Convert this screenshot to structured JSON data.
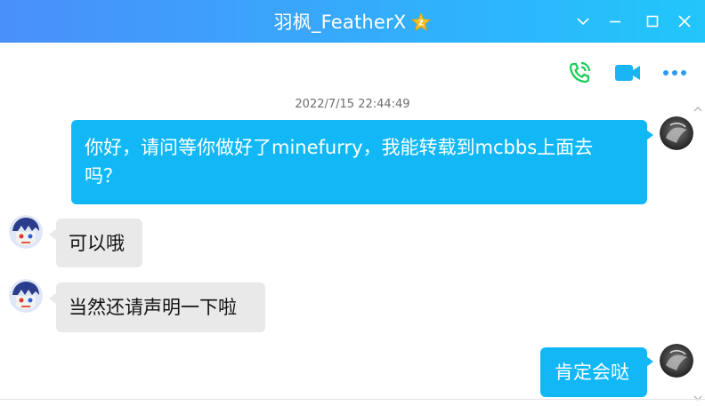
{
  "window": {
    "title": "羽枫_FeatherX",
    "badge_icon": "gold-star-badge-icon",
    "controls": [
      "chevron-down-icon",
      "minimize-icon",
      "maximize-icon",
      "close-icon"
    ]
  },
  "toolbar": {
    "icons": [
      "voice-call-icon",
      "video-call-icon",
      "more-icon"
    ],
    "call_color": "#1ccc59",
    "video_color": "#1ab4f2",
    "more_color": "#2b9cf2"
  },
  "chat": {
    "timestamp": "2022/7/15 22:44:49",
    "messages": [
      {
        "side": "out",
        "lines": [
          "你好，请问等你做好了minefurry，我能转载到mcbbs上面去",
          "吗？"
        ]
      },
      {
        "side": "in",
        "text": "可以哦"
      },
      {
        "side": "in",
        "text": "当然还请声明一下啦"
      },
      {
        "side": "out",
        "text": "肯定会哒"
      }
    ]
  },
  "colors": {
    "title_gradient_start": "#4a8ffb",
    "title_gradient_end": "#21c6fb",
    "outgoing_bubble": "#12b8f6",
    "incoming_bubble": "#e9e9e9"
  }
}
